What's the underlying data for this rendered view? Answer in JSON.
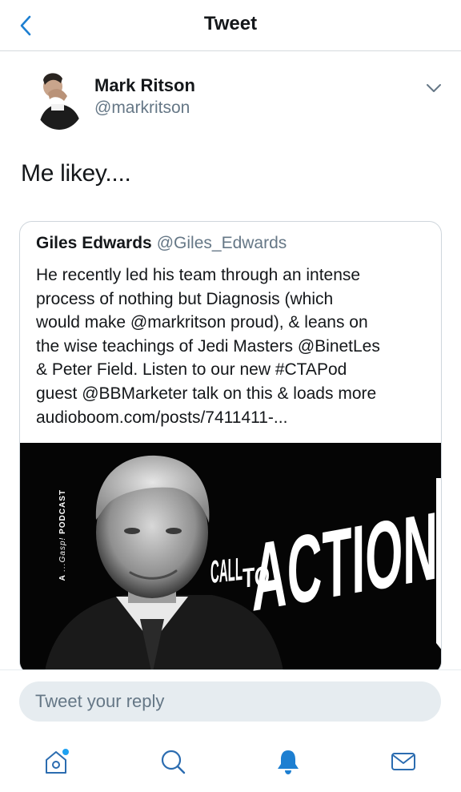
{
  "header": {
    "title": "Tweet"
  },
  "tweet": {
    "author_name": "Mark Ritson",
    "author_handle": "@markritson",
    "text": "Me likey...."
  },
  "quoted_tweet": {
    "author_name": "Giles Edwards",
    "author_handle": "@Giles_Edwards",
    "text": "He recently led his team through an intense\nprocess of nothing but Diagnosis (which\nwould make @markritson proud), & leans on\nthe wise teachings of Jedi Masters @BinetLes\n& Peter Field. Listen to our new #CTAPod\nguest @BBMarketer talk on this & loads more\naudioboom.com/posts/7411411-...",
    "media": {
      "side_label_prefix": "A",
      "side_label_brand": "...Gasp!",
      "side_label_suffix": "PODCAST",
      "title_small": "CALL TO",
      "title_big": "ACTION"
    }
  },
  "reply": {
    "placeholder": "Tweet your reply"
  },
  "tabbar": {
    "items": [
      {
        "icon": "home-icon",
        "has_notification_dot": true
      },
      {
        "icon": "search-icon"
      },
      {
        "icon": "notifications-icon",
        "active": true
      },
      {
        "icon": "messages-icon"
      }
    ],
    "accent_color": "#1da1f2",
    "inactive_color": "#2b6cb0"
  }
}
